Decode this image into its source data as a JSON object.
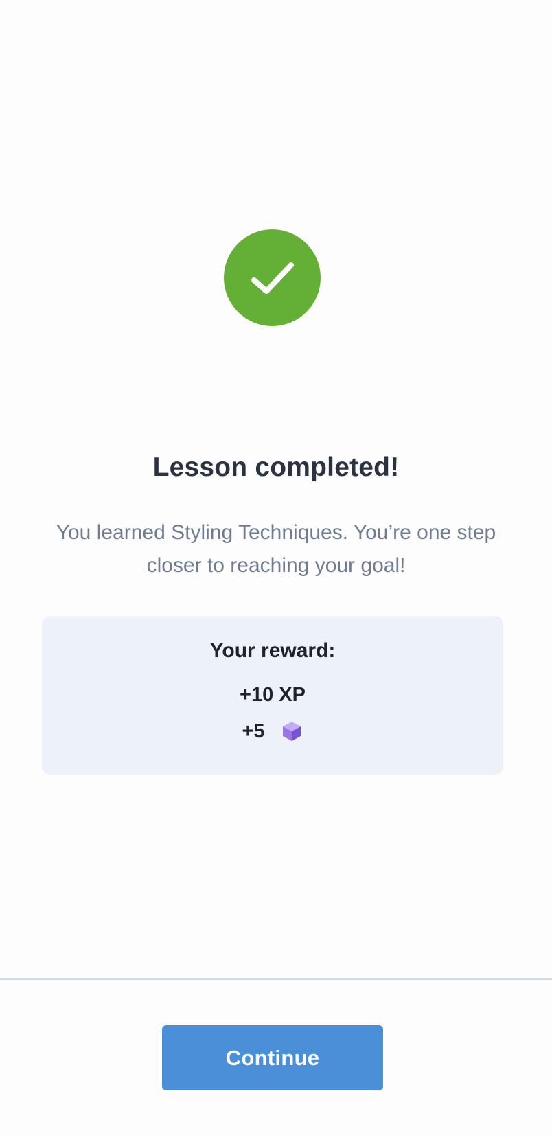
{
  "completion": {
    "icon": "checkmark-circle-icon",
    "title": "Lesson completed!",
    "message": "You learned Styling Techniques. You’re one step closer to reaching your goal!"
  },
  "reward": {
    "title": "Your reward:",
    "xp": "+10 XP",
    "gems": "+5",
    "gem_icon": "purple-cube-icon"
  },
  "footer": {
    "continue_label": "Continue"
  },
  "colors": {
    "success_green": "#64af35",
    "card_background": "#ecf1fa",
    "primary_blue": "#4a90d9",
    "title_text": "#2b3340",
    "body_text": "#6e7b91",
    "gem_purple": "#9a73e6"
  }
}
